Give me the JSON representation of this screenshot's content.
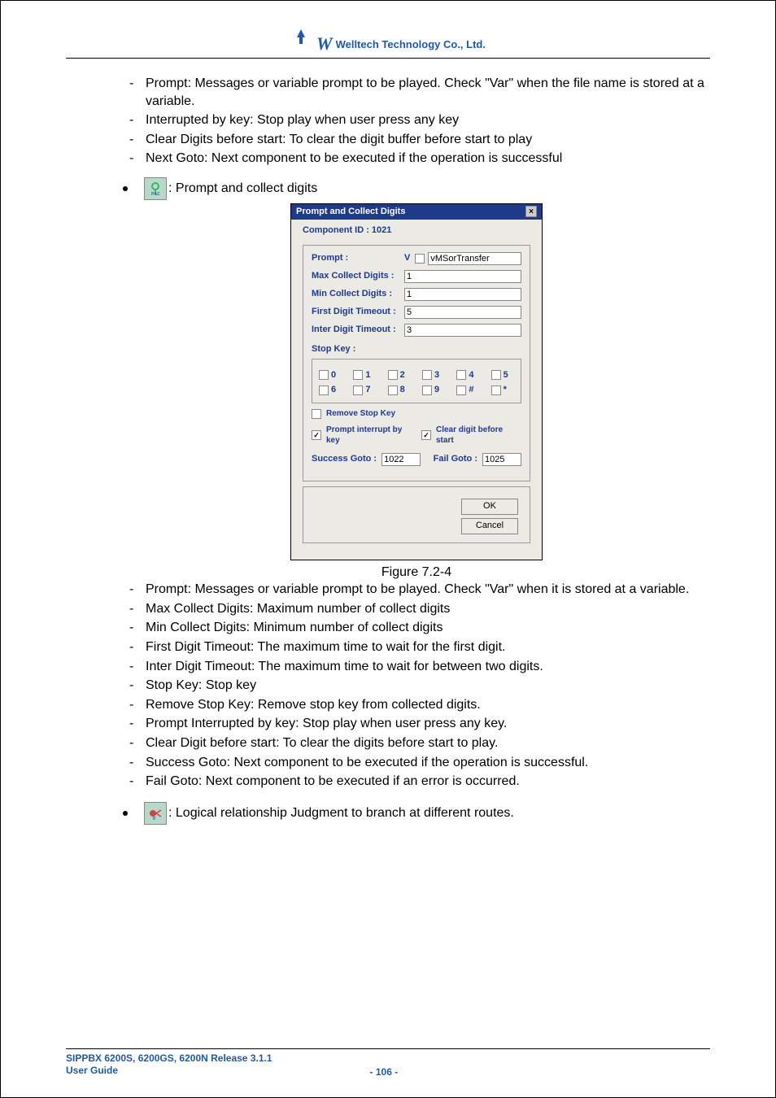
{
  "header": {
    "logo": "W",
    "company": "Welltech Technology Co., Ltd."
  },
  "section1": {
    "items": [
      "Prompt: Messages or variable prompt to be played. Check \"Var\" when the file name is stored at a variable.",
      "Interrupted by key: Stop play when user press any key",
      "Clear Digits before start:  To clear the digit buffer before start to play",
      "Next Goto: Next component to be executed if the operation is successful"
    ]
  },
  "bullet1": {
    "text": ": Prompt and collect digits"
  },
  "dialog": {
    "title": "Prompt and Collect Digits",
    "componentId": "Component ID : 1021",
    "promptLabel": "Prompt :",
    "vLabel": "V",
    "promptValue": "vMSorTransfer",
    "maxLabel": "Max Collect Digits :",
    "maxValue": "1",
    "minLabel": "Min Collect Digits :",
    "minValue": "1",
    "firstLabel": "First Digit Timeout :",
    "firstValue": "5",
    "interLabel": "Inter Digit Timeout :",
    "interValue": "3",
    "stopKeyLabel": "Stop Key :",
    "keys": [
      "0",
      "1",
      "2",
      "3",
      "4",
      "5",
      "6",
      "7",
      "8",
      "9",
      "#",
      "*"
    ],
    "removeLabel": "Remove Stop Key",
    "interruptLabel": "Prompt interrupt by key",
    "clearLabel": "Clear digit before start",
    "successLabel": "Success Goto :",
    "successValue": "1022",
    "failLabel": "Fail Goto :",
    "failValue": "1025",
    "ok": "OK",
    "cancel": "Cancel"
  },
  "figCaption": "Figure 7.2-4",
  "section2": {
    "items": [
      "Prompt: Messages or variable prompt to be played. Check \"Var\" when it is stored at a variable.",
      "Max Collect Digits: Maximum number of collect digits",
      "Min Collect Digits: Minimum number of collect digits",
      "First Digit Timeout: The maximum time to wait for the first digit.",
      "Inter Digit Timeout: The maximum time to wait for between two digits.",
      "Stop Key: Stop key",
      "Remove Stop Key: Remove stop key from collected digits.",
      "Prompt Interrupted by key: Stop play when user press any key.",
      "Clear Digit before start: To clear the digits before start to play.",
      "Success Goto: Next component to be executed if the operation is successful.",
      "Fail Goto: Next component to be executed if an error is occurred."
    ]
  },
  "bullet2": {
    "text": ": Logical relationship Judgment to branch at different routes."
  },
  "footer": {
    "line1": "SIPPBX 6200S, 6200GS, 6200N Release 3.1.1",
    "line2": "User Guide",
    "page": "- 106 -"
  }
}
